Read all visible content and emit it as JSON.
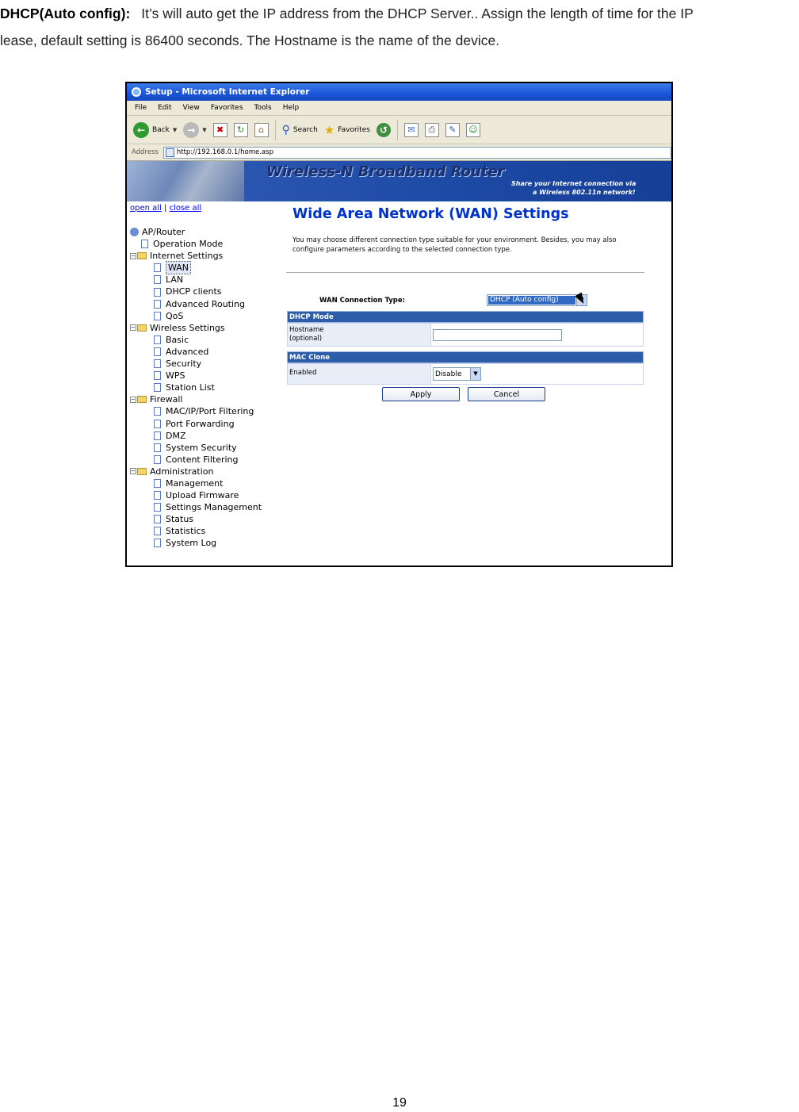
{
  "doc": {
    "term": "DHCP(Auto config):",
    "line1": "It’s will auto get the IP address from the DHCP Server.. Assign the length of time for the IP",
    "line2": "lease, default setting is 86400 seconds. The Hostname is the name of the device.",
    "page_number": "19"
  },
  "browser": {
    "title": "Setup - Microsoft Internet Explorer",
    "menu": [
      "File",
      "Edit",
      "View",
      "Favorites",
      "Tools",
      "Help"
    ],
    "toolbar": {
      "back": "Back",
      "search": "Search",
      "favorites": "Favorites"
    },
    "address_label": "Address",
    "address": "http://192.168.0.1/home.asp"
  },
  "banner": {
    "brand": "Wireless-N Broadband Router",
    "tag1": "Share your Internet connection via",
    "tag2": "a Wireless 802.11n network!"
  },
  "nav": {
    "open_all": "open all",
    "close_all": "close all",
    "root": "AP/Router",
    "operation_mode": "Operation Mode",
    "internet": {
      "label": "Internet Settings",
      "items": [
        "WAN",
        "LAN",
        "DHCP clients",
        "Advanced Routing",
        "QoS"
      ]
    },
    "wireless": {
      "label": "Wireless Settings",
      "items": [
        "Basic",
        "Advanced",
        "Security",
        "WPS",
        "Station List"
      ]
    },
    "firewall": {
      "label": "Firewall",
      "items": [
        "MAC/IP/Port Filtering",
        "Port Forwarding",
        "DMZ",
        "System Security",
        "Content Filtering"
      ]
    },
    "admin": {
      "label": "Administration",
      "items": [
        "Management",
        "Upload Firmware",
        "Settings Management",
        "Status",
        "Statistics",
        "System Log"
      ]
    }
  },
  "wan": {
    "title": "Wide Area Network (WAN) Settings",
    "desc": "You may choose different connection type suitable for your environment. Besides, you may also configure parameters according to the selected connection type.",
    "conn_type_label": "WAN Connection Type:",
    "conn_type_value": "DHCP (Auto config)",
    "dhcp_header": "DHCP Mode",
    "hostname_label1": "Hostname",
    "hostname_label2": "(optional)",
    "hostname_value": "",
    "mac_header": "MAC Clone",
    "enabled_label": "Enabled",
    "enabled_value": "Disable",
    "apply": "Apply",
    "cancel": "Cancel"
  }
}
